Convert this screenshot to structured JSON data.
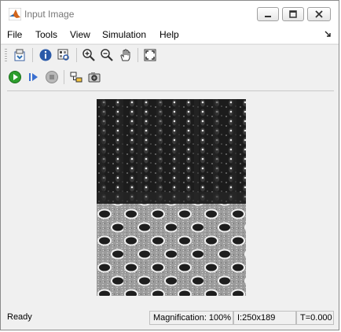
{
  "window": {
    "title": "Input Image"
  },
  "menu": [
    "File",
    "Tools",
    "View",
    "Simulation",
    "Help"
  ],
  "toolbar1": [
    {
      "icon": "print-to-figure-icon"
    },
    {
      "icon": "info-icon"
    },
    {
      "icon": "pixel-region-icon"
    },
    {
      "icon": "zoom-in-icon"
    },
    {
      "icon": "zoom-out-icon"
    },
    {
      "icon": "pan-hand-icon"
    },
    {
      "icon": "fit-to-view-icon"
    }
  ],
  "toolbar2": [
    {
      "icon": "run-icon"
    },
    {
      "icon": "step-forward-icon"
    },
    {
      "icon": "stop-icon"
    },
    {
      "icon": "highlight-block-icon"
    },
    {
      "icon": "snapshot-camera-icon"
    }
  ],
  "status": {
    "text": "Ready",
    "magnification": "Magnification: 100%",
    "size": "I:250x189",
    "time": "T=0.000"
  },
  "colors": {
    "run_green": "#2e9e2e",
    "step_blue": "#3a6fd0",
    "stop_gray": "#9a9a9a"
  }
}
